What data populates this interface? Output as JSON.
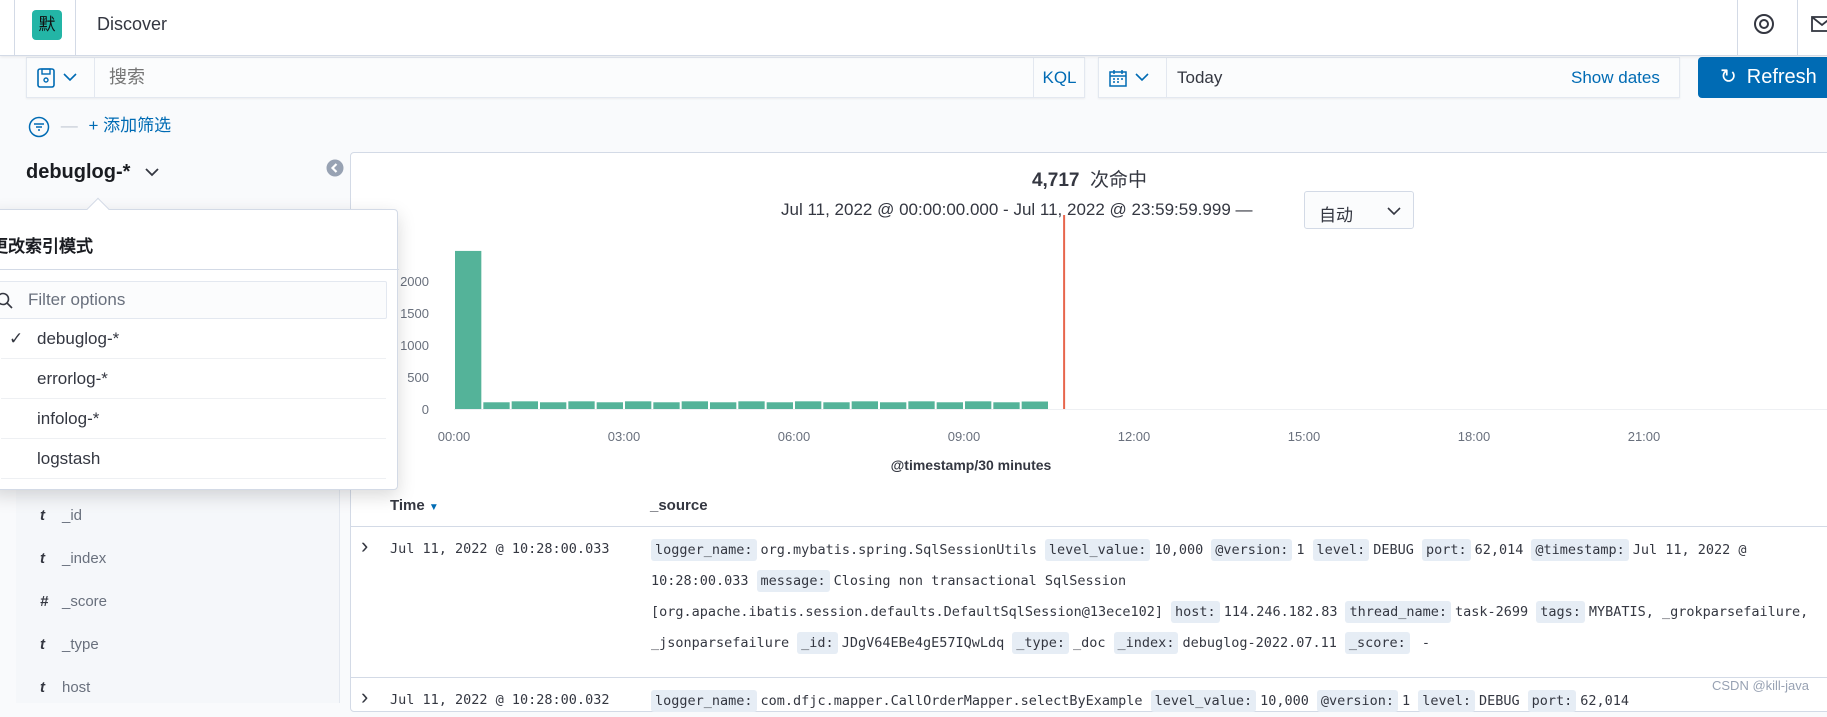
{
  "header": {
    "logo_text": "默",
    "title": "Discover",
    "icons": [
      "help-icon",
      "mail-icon"
    ]
  },
  "query": {
    "placeholder": "搜索",
    "language": "KQL"
  },
  "date": {
    "value": "Today",
    "show_dates": "Show dates",
    "refresh": "Refresh"
  },
  "filter": {
    "add": "+ 添加筛选"
  },
  "index_pattern": {
    "current": "debuglog-*"
  },
  "popover": {
    "title": "更改索引模式",
    "filter_placeholder": "Filter options",
    "options": [
      {
        "label": "debuglog-*",
        "checked": true
      },
      {
        "label": "errorlog-*",
        "checked": false
      },
      {
        "label": "infolog-*",
        "checked": false
      },
      {
        "label": "logstash",
        "checked": false
      }
    ]
  },
  "fields": [
    {
      "type": "t",
      "name": "_id"
    },
    {
      "type": "t",
      "name": "_index"
    },
    {
      "type": "#",
      "name": "_score"
    },
    {
      "type": "t",
      "name": "_type"
    },
    {
      "type": "t",
      "name": "host"
    }
  ],
  "results": {
    "count": "4,717",
    "count_label": "次命中",
    "range": "Jul 11, 2022 @ 00:00:00.000 - Jul 11, 2022 @ 23:59:59.999 —",
    "interval": "自动"
  },
  "chart_data": {
    "type": "bar",
    "xlabel": "@timestamp/30 minutes",
    "x_ticks": [
      "00:00",
      "03:00",
      "06:00",
      "09:00",
      "12:00",
      "15:00",
      "18:00",
      "21:00"
    ],
    "y_ticks": [
      "0",
      "500",
      "1000",
      "1500",
      "2000"
    ],
    "ylim": [
      0,
      2500
    ],
    "x_range": [
      "00:00",
      "24:00"
    ],
    "interval_minutes": 30,
    "x": [
      "00:00",
      "00:30",
      "01:00",
      "01:30",
      "02:00",
      "02:30",
      "03:00",
      "03:30",
      "04:00",
      "04:30",
      "05:00",
      "05:30",
      "06:00",
      "06:30",
      "07:00",
      "07:30",
      "08:00",
      "08:30",
      "09:00",
      "09:30",
      "10:00"
    ],
    "values": [
      2470,
      105,
      120,
      105,
      120,
      105,
      120,
      105,
      120,
      105,
      120,
      105,
      120,
      105,
      120,
      105,
      120,
      105,
      120,
      105,
      117
    ],
    "current_time_marker": "10:46",
    "colors": {
      "bar": "#54b399",
      "marker": "#e7664c"
    }
  },
  "table": {
    "headers": {
      "time": "Time",
      "source": "_source"
    },
    "rows": [
      {
        "time": "Jul 11, 2022 @ 10:28:00.033",
        "fields": [
          [
            "logger_name:",
            "org.mybatis.spring.SqlSessionUtils"
          ],
          [
            "level_value:",
            "10,000"
          ],
          [
            "@version:",
            "1"
          ],
          [
            "level:",
            "DEBUG"
          ],
          [
            "port:",
            "62,014"
          ],
          [
            "@timestamp:",
            "Jul 11, 2022 @ 10:28:00.033"
          ],
          [
            "message:",
            "Closing non transactional SqlSession [org.apache.ibatis.session.defaults.DefaultSqlSession@13ece102]"
          ],
          [
            "host:",
            "114.246.182.83"
          ],
          [
            "thread_name:",
            "task-2699"
          ],
          [
            "tags:",
            "MYBATIS, _grokparsefailure, _jsonparsefailure"
          ],
          [
            "_id:",
            "JDgV64EBe4gE57IQwLdq"
          ],
          [
            "_type:",
            "_doc"
          ],
          [
            "_index:",
            "debuglog-2022.07.11"
          ],
          [
            "_score:",
            " -"
          ]
        ]
      },
      {
        "time": "Jul 11, 2022 @ 10:28:00.032",
        "fields": [
          [
            "logger_name:",
            "com.dfjc.mapper.CallOrderMapper.selectByExample"
          ],
          [
            "level_value:",
            "10,000"
          ],
          [
            "@version:",
            "1"
          ],
          [
            "level:",
            "DEBUG"
          ],
          [
            "port:",
            "62,014"
          ]
        ]
      }
    ]
  },
  "watermark": "CSDN @kill-java"
}
